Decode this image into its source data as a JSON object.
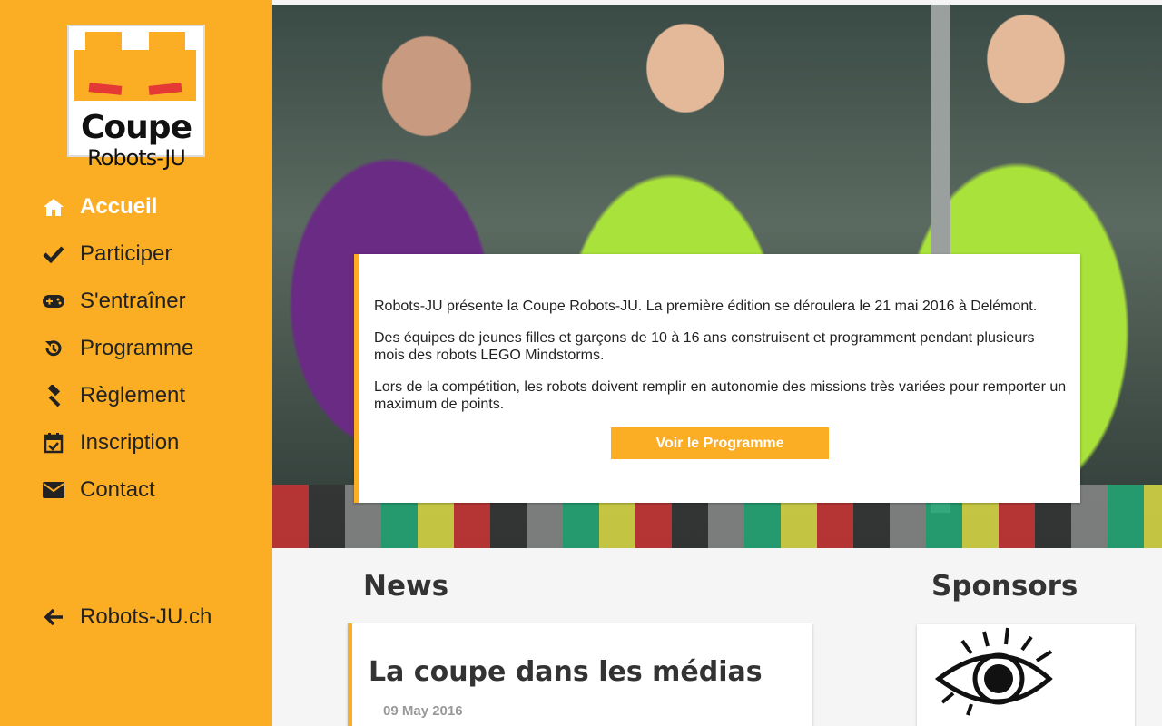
{
  "logo": {
    "line1": "Coupe",
    "line2": "Robots-JU"
  },
  "nav": {
    "items": [
      {
        "label": "Accueil",
        "icon": "home-icon",
        "active": true
      },
      {
        "label": "Participer",
        "icon": "check-icon"
      },
      {
        "label": "S'entraîner",
        "icon": "gamepad-icon"
      },
      {
        "label": "Programme",
        "icon": "history-icon"
      },
      {
        "label": "Règlement",
        "icon": "gavel-icon"
      },
      {
        "label": "Inscription",
        "icon": "calendar-check-icon"
      },
      {
        "label": "Contact",
        "icon": "envelope-icon"
      }
    ],
    "back_label": "Robots-JU.ch"
  },
  "intro": {
    "p1": "Robots-JU présente la Coupe Robots-JU. La première édition se déroulera le 21 mai 2016 à Delémont.",
    "p2": "Des équipes de jeunes filles et garçons de 10 à 16 ans construisent et programment pendant plusieurs mois des robots LEGO Mindstorms.",
    "p3": "Lors de la compétition, les robots doivent remplir en autonomie des missions très variées pour remporter un maximum de points.",
    "cta": "Voir le Programme"
  },
  "news": {
    "heading": "News",
    "items": [
      {
        "title": "La coupe dans les médias",
        "date": "09 May 2016"
      }
    ]
  },
  "sponsors": {
    "heading": "Sponsors"
  },
  "colors": {
    "accent": "#fbae24",
    "text": "#222222"
  }
}
